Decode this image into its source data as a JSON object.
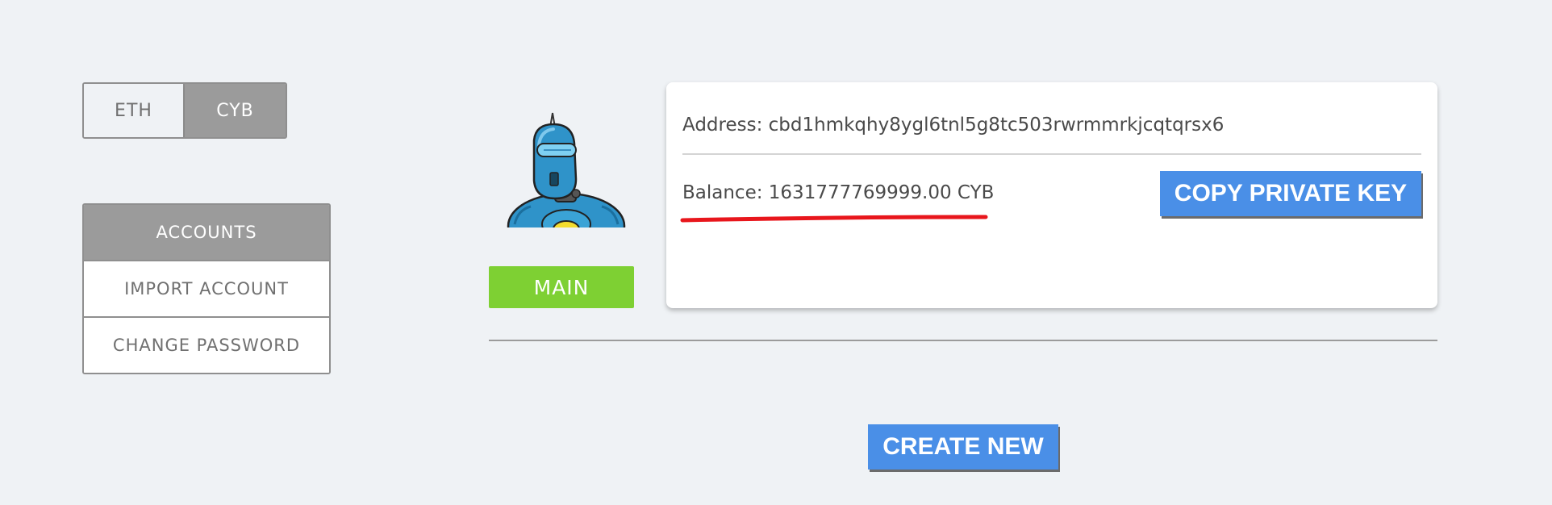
{
  "network_toggle": {
    "options": [
      {
        "label": "ETH",
        "selected": false
      },
      {
        "label": "CYB",
        "selected": true
      }
    ]
  },
  "side_menu": {
    "items": [
      {
        "label": "ACCOUNTS",
        "active": true
      },
      {
        "label": "IMPORT ACCOUNT",
        "active": false
      },
      {
        "label": "CHANGE PASSWORD",
        "active": false
      }
    ]
  },
  "account": {
    "avatar": "robot-avatar",
    "main_label": "MAIN",
    "address": "Address: cbd1hmkqhy8ygl6tnl5g8tc503rwrmmrkjcqtqrsx6",
    "balance": "Balance: 1631777769999.00 CYB",
    "copy_private_key_label": "COPY PRIVATE KEY"
  },
  "actions": {
    "create_new_label": "CREATE NEW"
  },
  "colors": {
    "background": "#eff2f5",
    "selected_gray": "#9b9b9b",
    "main_green": "#7ed033",
    "button_blue": "#4a8fe7",
    "annotation_red": "#e8161c"
  }
}
